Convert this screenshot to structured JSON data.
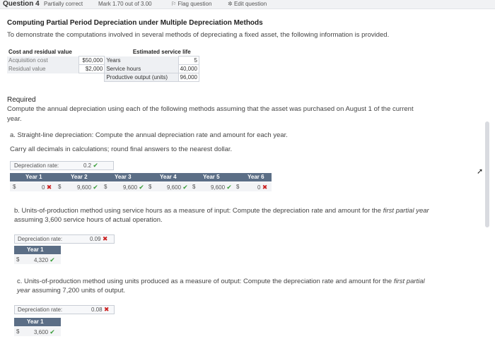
{
  "topbar": {
    "question": "Question 4",
    "status": "Partially correct",
    "mark": "Mark 1.70 out of 3.00",
    "flag": "Flag question",
    "edit": "Edit question"
  },
  "heading": {
    "title": "Computing Partial Period Depreciation under Multiple Depreciation Methods",
    "intro": "To demonstrate the computations involved in several methods of depreciating a fixed asset, the following information is provided."
  },
  "cost_table": {
    "col1_header": "Cost and residual value",
    "col2_header": "Estimated service life",
    "rows": [
      {
        "label": "Acquisition cost",
        "amount": "$50,000",
        "life_label": "Years",
        "life_value": "5"
      },
      {
        "label": "Residual value",
        "amount": "$2,000",
        "life_label": "Service hours",
        "life_value": "40,000"
      },
      {
        "label": "",
        "amount": "",
        "life_label": "Productive output (units)",
        "life_value": "96,000"
      }
    ]
  },
  "required": {
    "heading": "Required",
    "text1": "Compute the annual depreciation using each of the following methods assuming that the asset was purchased on August 1 of the current",
    "text2": "year."
  },
  "part_a": {
    "instruction": "a. Straight-line depreciation: Compute the annual depreciation rate and amount for each year.",
    "note": "Carry all decimals in calculations; round final answers to the nearest dollar.",
    "rate_label": "Depreciation rate:",
    "rate_value": "0.2",
    "currency": "$",
    "years": [
      "Year 1",
      "Year 2",
      "Year 3",
      "Year 4",
      "Year 5",
      "Year 6"
    ],
    "values": [
      "0",
      "9,600",
      "9,600",
      "9,600",
      "9,600",
      "0"
    ]
  },
  "part_b": {
    "instruction_pre": "b. Units-of-production method using service hours as a measure of input: Compute the depreciation rate and amount for the ",
    "instruction_em": "first partial year",
    "instruction_post": " assuming 3,600 service hours of actual operation.",
    "rate_label": "Depreciation rate:",
    "rate_value": "0.09",
    "year": "Year 1",
    "currency": "$",
    "value": "4,320"
  },
  "part_c": {
    "instruction_pre": "c. Units-of-production method using units produced as a measure of output: Compute the depreciation rate and amount for the ",
    "instruction_em": "first partial",
    "instruction_em2": "year",
    "instruction_post": " assuming 7,200 units of output.",
    "rate_label": "Depreciation rate:",
    "rate_value": "0.08",
    "year": "Year 1",
    "currency": "$",
    "value": "3,600"
  },
  "colors": {
    "header_bg": "#5b6e86",
    "correct": "#3a9d3a",
    "incorrect": "#cc2222"
  }
}
